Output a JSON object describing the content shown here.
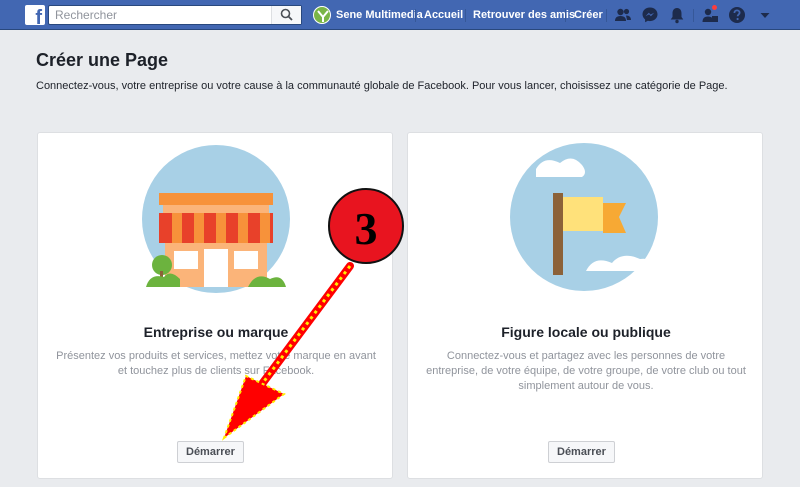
{
  "topbar": {
    "search_placeholder": "Rechercher",
    "profile_name": "Sene Multimedia",
    "links": [
      "Accueil",
      "Retrouver des amis",
      "Créer"
    ]
  },
  "page": {
    "title": "Créer une Page",
    "subtitle": "Connectez-vous, votre entreprise ou votre cause à la communauté globale de Facebook. Pour vous lancer, choisissez une catégorie de Page."
  },
  "cards": [
    {
      "title": "Entreprise ou marque",
      "description": "Présentez vos produits et services, mettez votre marque en avant et touchez plus de clients sur Facebook.",
      "button": "Démarrer"
    },
    {
      "title": "Figure locale ou publique",
      "description": "Connectez-vous et partagez avec les personnes de votre entreprise, de votre équipe, de votre groupe, de votre club ou tout simplement autour de vous.",
      "button": "Démarrer"
    }
  ],
  "annotation": {
    "step_number": "3"
  },
  "colors": {
    "brand_blue": "#4267b2",
    "page_bg": "#e9ebee",
    "annotation_red": "#ff0000",
    "annotation_yellow": "#ffee00"
  },
  "icons": {
    "logo": "facebook-logo",
    "search": "search-icon",
    "friends": "friends-icon",
    "messenger": "messenger-icon",
    "notifications": "bell-icon",
    "quick_help": "question-icon",
    "menu": "chevron-down-icon"
  }
}
